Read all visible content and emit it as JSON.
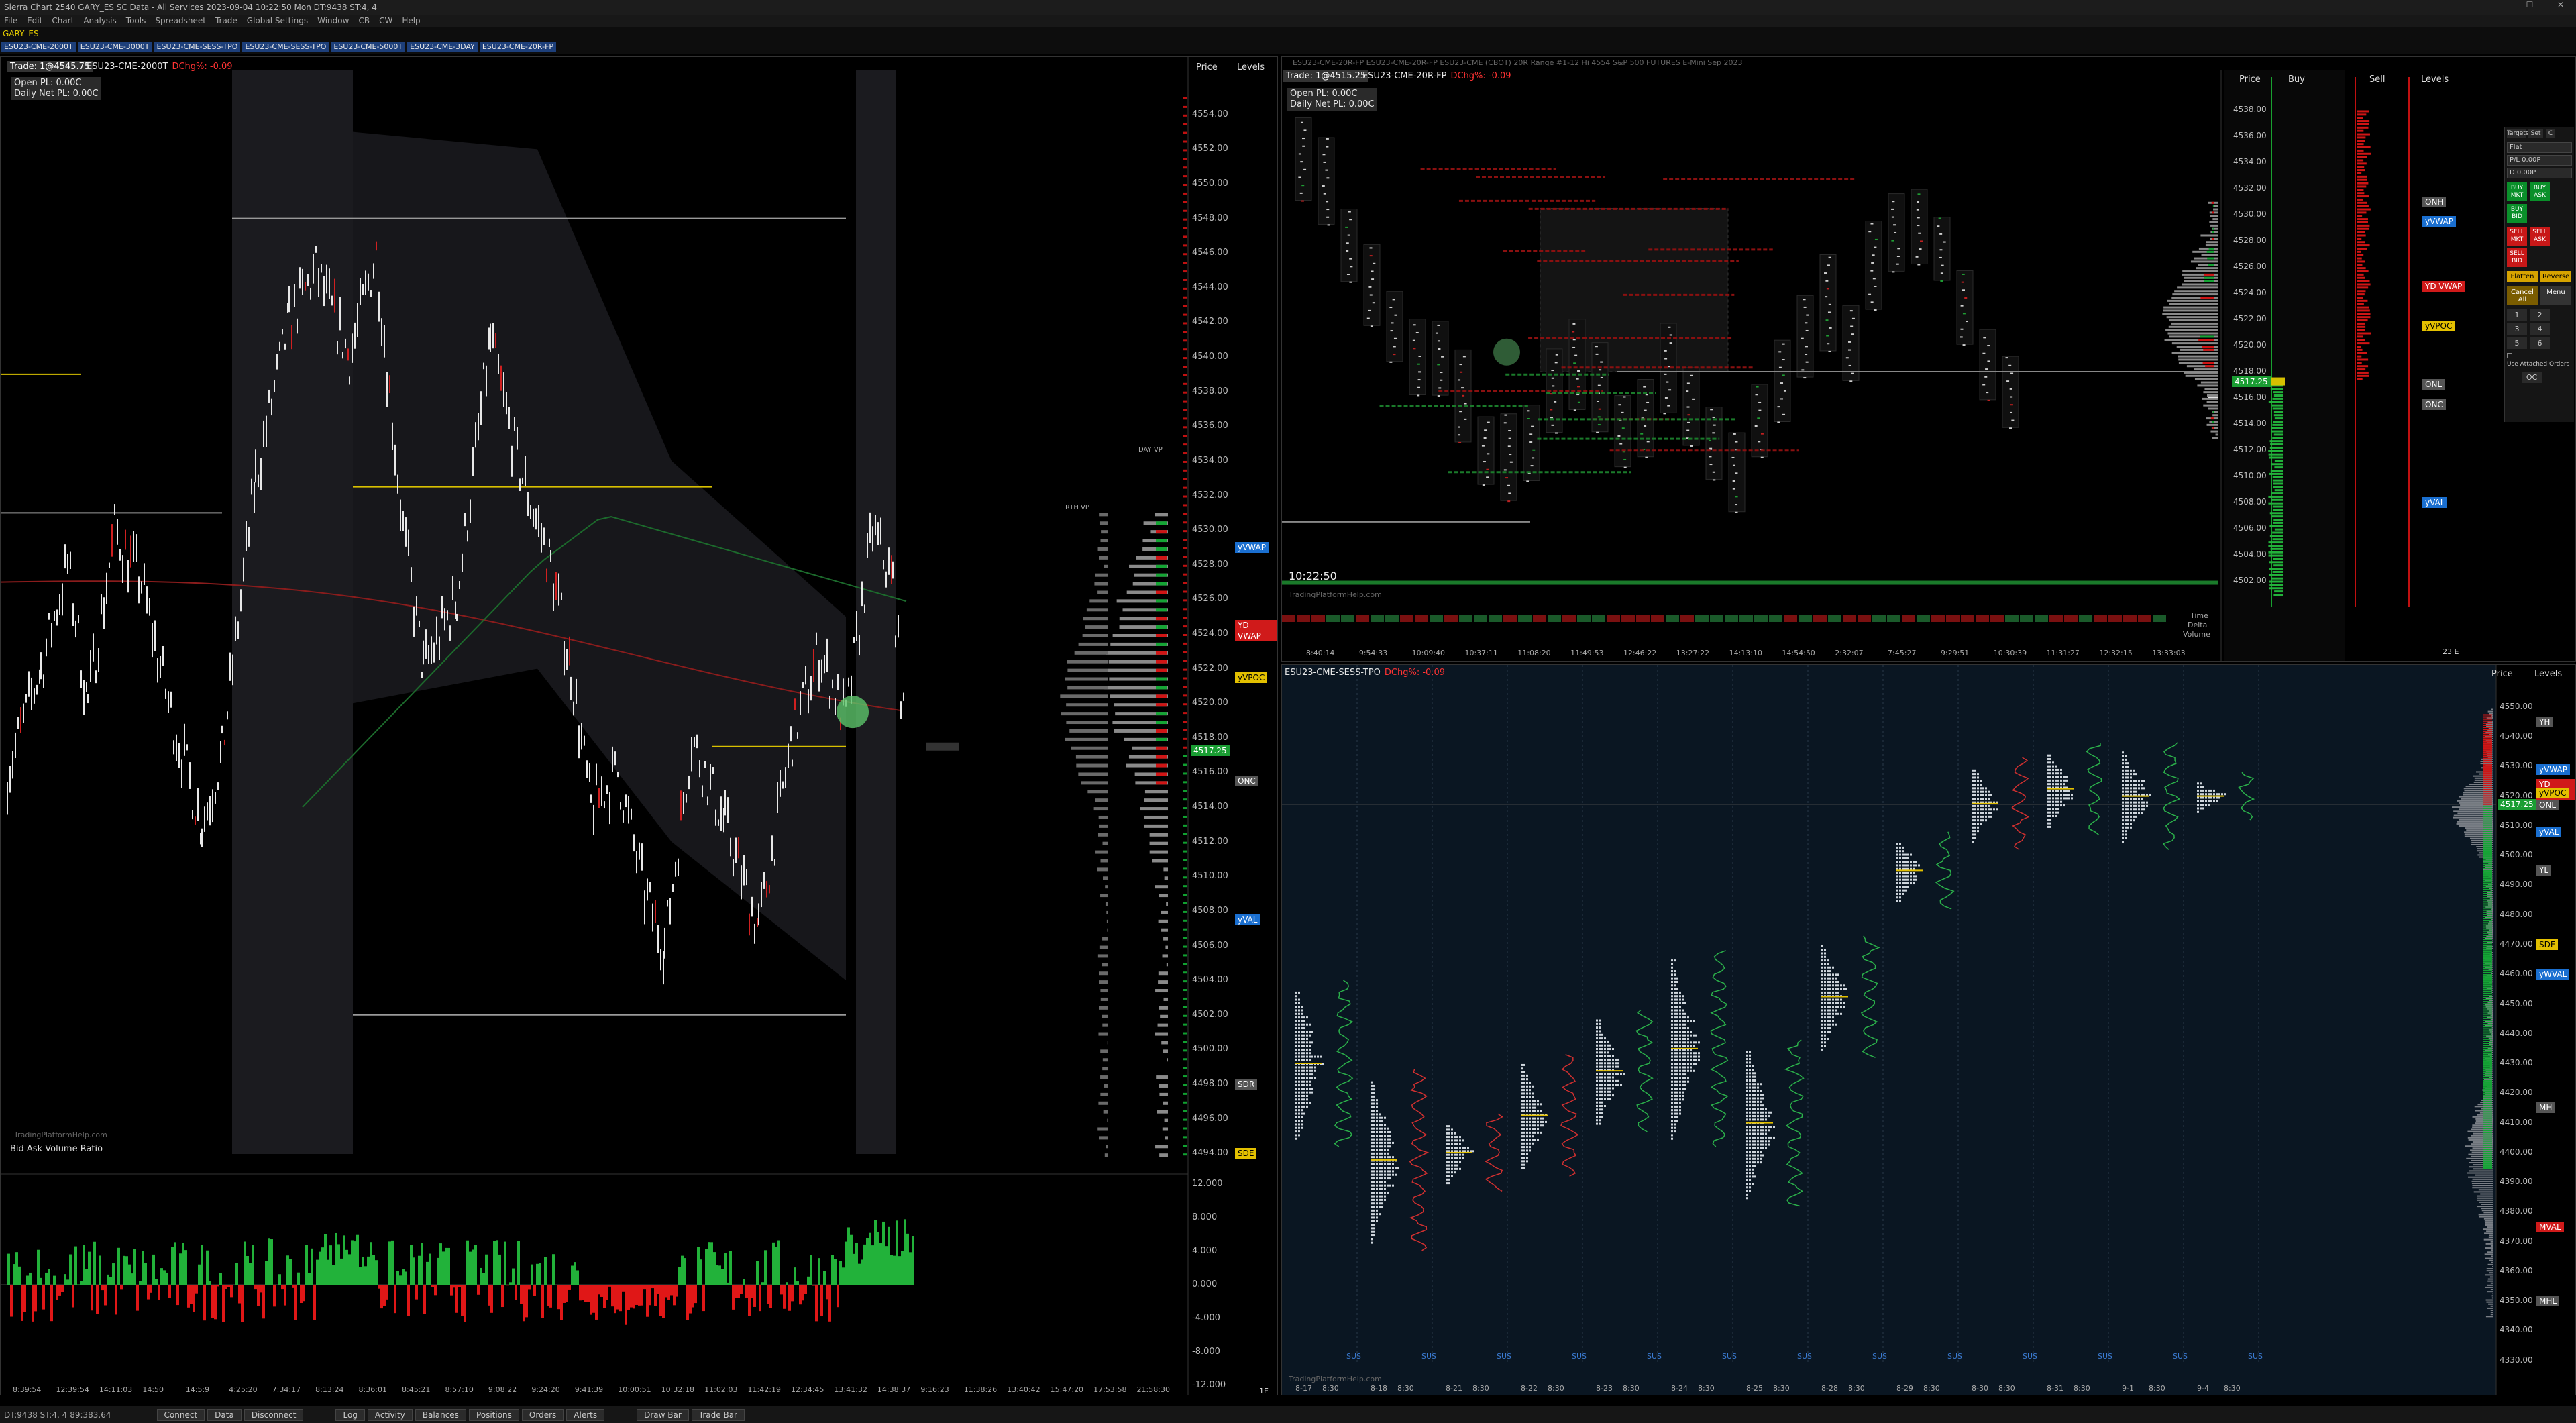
{
  "window": {
    "title": "Sierra Chart 2540 GARY_ES SC Data - All Services 2023-09-04 10:22:50 Mon DT:9438 ST:4, 4"
  },
  "menu": [
    "File",
    "Edit",
    "Chart",
    "Analysis",
    "Tools",
    "Spreadsheet",
    "Trade",
    "Global Settings",
    "Window",
    "CB",
    "CW",
    "Help"
  ],
  "symbol": "GARY_ES",
  "tabs": [
    "ESU23-CME-2000T",
    "ESU23-CME-3000T",
    "ESU23-CME-SESS-TPO",
    "ESU23-CME-SESS-TPO",
    "ESU23-CME-5000T",
    "ESU23-CME-3DAY",
    "ESU23-CME-20R-FP"
  ],
  "left_chart": {
    "trade": "Trade: 1@4545.75",
    "symbol": "ESU23-CME-2000T",
    "change": "DChg%: -0.09",
    "open_pl": "Open PL: 0.00C",
    "daily_pl": "Daily Net PL: 0.00C",
    "hdr_price": "Price",
    "hdr_levels": "Levels",
    "prices": [
      "4554.00",
      "4552.00",
      "4550.00",
      "4548.00",
      "4546.00",
      "4544.00",
      "4542.00",
      "4540.00",
      "4538.00",
      "4536.00",
      "4534.00",
      "4532.00",
      "4530.00",
      "4528.00",
      "4526.00",
      "4524.00",
      "4522.00",
      "4520.00",
      "4518.00",
      "4516.00",
      "4514.00",
      "4512.00",
      "4510.00",
      "4508.00",
      "4506.00",
      "4504.00",
      "4502.00",
      "4500.00",
      "4498.00",
      "4496.00",
      "4494.00"
    ],
    "current_price": "4517.25",
    "levels": [
      {
        "label": "yVWAP",
        "color": "#1a6fd0",
        "price": 4529
      },
      {
        "label": "YD VWAP",
        "color": "#d01a1a",
        "price": 4524.5
      },
      {
        "label": "yVPOC",
        "color": "#e3c000",
        "price": 4521.5
      },
      {
        "label": "ONC",
        "color": "#555555",
        "price": 4515.5
      },
      {
        "label": "yVAL",
        "color": "#1a6fd0",
        "price": 4507.5
      },
      {
        "label": "SDR",
        "color": "#555555",
        "price": 4498
      },
      {
        "label": "SDE",
        "color": "#e3c000",
        "price": 4494
      }
    ],
    "times": [
      "8:39:54",
      "12:39:54",
      "14:11:03",
      "14:50",
      "14:5:9",
      "4:25:20",
      "7:34:17",
      "8:13:24",
      "8:36:01",
      "8:45:21",
      "8:57:10",
      "9:08:22",
      "9:24:20",
      "9:41:39",
      "10:00:51",
      "10:32:18",
      "11:02:03",
      "11:42:19",
      "12:34:45",
      "13:41:32",
      "14:38:37",
      "9:16:23",
      "11:38:26",
      "13:40:42",
      "15:47:20",
      "17:53:58",
      "21:58:30"
    ],
    "vp_labels": [
      "DAY VP",
      "RTH VP"
    ],
    "watermark": "TradingPlatformHelp.com",
    "indicator": {
      "title": "Bid Ask Volume Ratio",
      "scale": [
        "12.000",
        "8.000",
        "4.000",
        "0.000",
        "-4.000",
        "-8.000",
        "-12.000"
      ]
    },
    "corner": "1E"
  },
  "top_right_chart": {
    "title_line": "ESU23-CME-20R-FP ESU23-CME-20R-FP ESU23-CME (CBOT) 20R Range #1-12 Hi 4554 S&P 500 FUTURES E-Mini Sep 2023",
    "trade": "Trade: 1@4515.25",
    "symbol": "ESU23-CME-20R-FP",
    "change": "DChg%: -0.09",
    "open_pl": "Open PL: 0.00C",
    "daily_pl": "Daily Net PL: 0.00C",
    "hdr_price": "Price",
    "hdr_buy": "Buy",
    "hdr_sell": "Sell",
    "hdr_levels": "Levels",
    "prices": [
      "4538.00",
      "4536.00",
      "4534.00",
      "4532.00",
      "4530.00",
      "4528.00",
      "4526.00",
      "4524.00",
      "4522.00",
      "4520.00",
      "4518.00",
      "4516.00",
      "4514.00",
      "4512.00",
      "4510.00",
      "4508.00",
      "4506.00",
      "4504.00",
      "4502.00"
    ],
    "current_price": "4517.25",
    "levels": [
      {
        "label": "ONH",
        "color": "#555555",
        "price": 4531
      },
      {
        "label": "yVWAP",
        "color": "#1a6fd0",
        "price": 4529.5
      },
      {
        "label": "YD VWAP",
        "color": "#d01a1a",
        "price": 4524.5
      },
      {
        "label": "yVPOC",
        "color": "#e3c000",
        "price": 4521.5
      },
      {
        "label": "ONL",
        "color": "#555555",
        "price": 4517
      },
      {
        "label": "ONC",
        "color": "#555555",
        "price": 4515.5
      },
      {
        "label": "yVAL",
        "color": "#1a6fd0",
        "price": 4508
      }
    ],
    "clock": "10:22:50",
    "row_labels": [
      "Time",
      "Delta",
      "Volume"
    ],
    "times": [
      "8:40:14",
      "9:54:33",
      "10:09:40",
      "10:37:11",
      "11:08:20",
      "11:49:53",
      "12:46:22",
      "13:27:22",
      "14:13:10",
      "14:54:50",
      "2:32:07",
      "7:45:27",
      "9:29:51",
      "10:30:39",
      "11:31:27",
      "12:32:15",
      "13:33:03"
    ],
    "watermark": "TradingPlatformHelp.com",
    "corner": "23 E",
    "trade_panel": {
      "targets": "Targets",
      "set": "Set",
      "c": "C",
      "flat": "Flat",
      "pl": "P/L 0.00P",
      "dp": "D 0.00P",
      "buy_mkt": "BUY MKT",
      "buy_ask": "BUY ASK",
      "buy_bid": "BUY BID",
      "sell_mkt": "SELL MKT",
      "sell_ask": "SELL ASK",
      "sell_bid": "SELL BID",
      "flatten": "Flatten",
      "reverse": "Reverse",
      "cancel_all": "Cancel All",
      "menu": "Menu",
      "nums": [
        "1",
        "2",
        "3",
        "4",
        "5",
        "6"
      ],
      "attached": "Use Attached Orders",
      "oc": "OC"
    }
  },
  "bottom_right_chart": {
    "symbol": "ESU23-CME-SESS-TPO",
    "change": "DChg%: -0.09",
    "hdr_price": "Price",
    "hdr_levels": "Levels",
    "prices": [
      "4550.00",
      "4540.00",
      "4530.00",
      "4520.00",
      "4510.00",
      "4500.00",
      "4490.00",
      "4480.00",
      "4470.00",
      "4460.00",
      "4450.00",
      "4440.00",
      "4430.00",
      "4420.00",
      "4410.00",
      "4400.00",
      "4390.00",
      "4380.00",
      "4370.00",
      "4360.00",
      "4350.00",
      "4340.00",
      "4330.00"
    ],
    "current_price": "4517.25",
    "dates": [
      "8-17",
      "8-18",
      "8-21",
      "8-22",
      "8-23",
      "8-24",
      "8-25",
      "8-28",
      "8-29",
      "8-30",
      "8-31",
      "9-1",
      "9-4"
    ],
    "session_time": "8:30",
    "session_tag": "SUS",
    "levels": [
      {
        "label": "YH",
        "color": "#555555",
        "price": 4545
      },
      {
        "label": "yVWAP",
        "color": "#1a6fd0",
        "price": 4529
      },
      {
        "label": "YD VWAP",
        "color": "#d01a1a",
        "price": 4524
      },
      {
        "label": "yVPOC",
        "color": "#e3c000",
        "price": 4521
      },
      {
        "label": "ONL",
        "color": "#555555",
        "price": 4517
      },
      {
        "label": "yVAL",
        "color": "#1a6fd0",
        "price": 4508
      },
      {
        "label": "YL",
        "color": "#555555",
        "price": 4495
      },
      {
        "label": "SDE",
        "color": "#e3c000",
        "price": 4470
      },
      {
        "label": "yWVAL",
        "color": "#1a6fd0",
        "price": 4460
      },
      {
        "label": "MH",
        "color": "#555555",
        "price": 4415
      },
      {
        "label": "MVAL",
        "color": "#d01a1a",
        "price": 4375
      },
      {
        "label": "MHL",
        "color": "#555555",
        "price": 4350
      }
    ],
    "watermark": "TradingPlatformHelp.com"
  },
  "status": {
    "left": "DT:9438 ST:4, 4",
    "sub": "89:383.64",
    "buttons": [
      "Connect",
      "Data",
      "Disconnect",
      "Log",
      "Activity",
      "Balances",
      "Positions",
      "Orders",
      "Alerts",
      "Draw Bar",
      "Trade Bar"
    ]
  }
}
